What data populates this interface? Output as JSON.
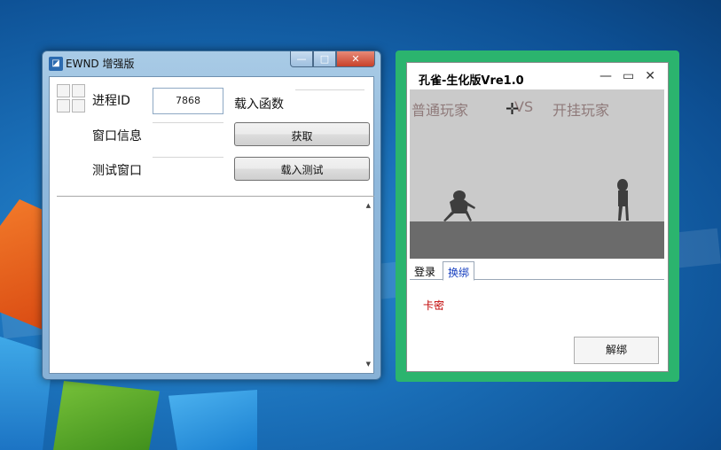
{
  "win1": {
    "title": "EWND 增强版",
    "minimize": "—",
    "maximize": "□",
    "close": "✕",
    "process_label": "进程ID",
    "process_value": "7868",
    "load_func_label": "载入函数",
    "window_info_label": "窗口信息",
    "get_button": "获取",
    "test_window_label": "测试窗口",
    "load_test_button": "载入测试"
  },
  "win2": {
    "title": "孔雀-生化版Vre1.0",
    "minimize": "—",
    "maximize": "▭",
    "close": "✕",
    "game": {
      "player_normal": "普通玩家",
      "vs": "VS",
      "player_cheat": "开挂玩家"
    },
    "tabs": [
      {
        "label": "登录"
      },
      {
        "label": "换绑"
      }
    ],
    "card_label": "卡密",
    "unbind_button": "解绑"
  },
  "colors": {
    "accent_green": "#2bb46e",
    "card_red": "#c00000",
    "tab_blue": "#1840c0"
  }
}
